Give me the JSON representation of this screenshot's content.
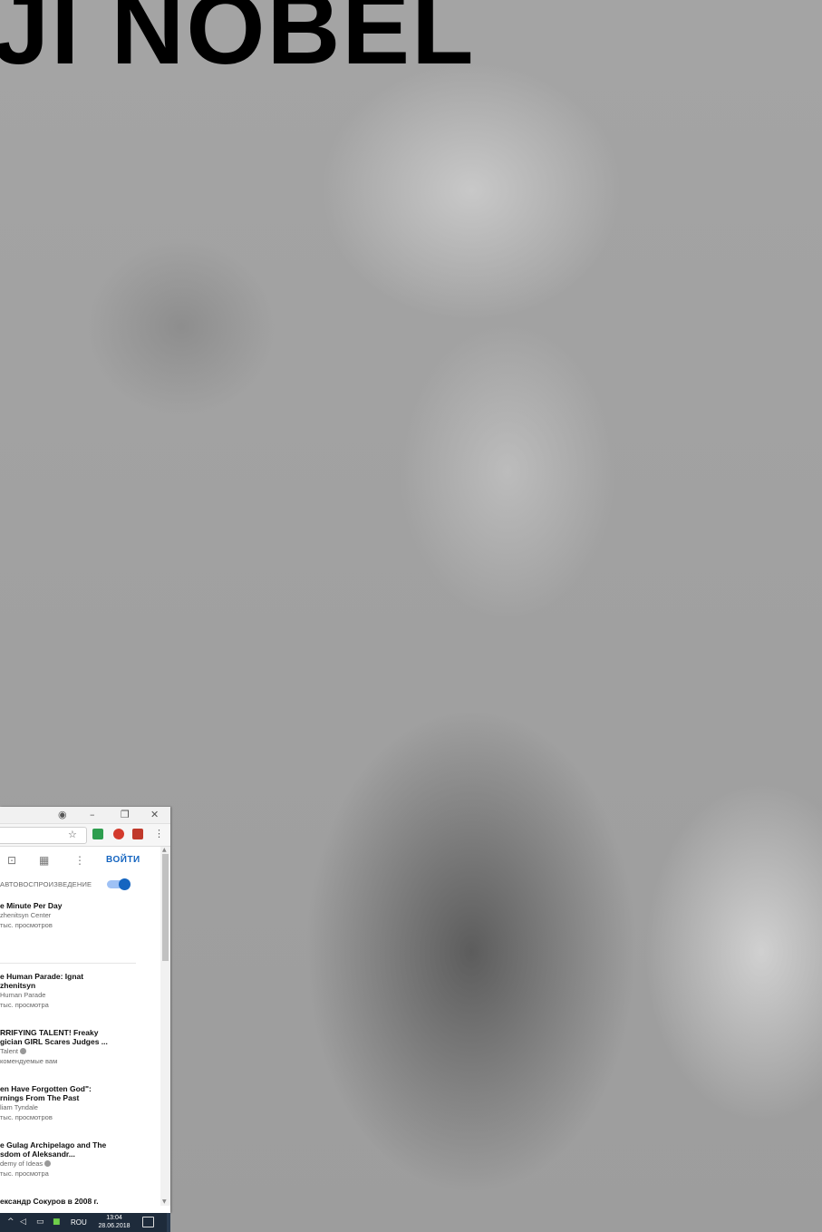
{
  "headline": "JI NOBEL",
  "window": {
    "titlebar": {
      "account_icon": "account-circle-icon",
      "minimize": "–",
      "restore": "❐",
      "close": "✕"
    },
    "addressbar": {
      "star_icon": "☆",
      "menu_icon": "⋮"
    },
    "header": {
      "camera_icon": "⊡",
      "apps_icon": "▦",
      "more_icon": "⋮",
      "signin_label": "ВОЙТИ"
    },
    "autoplay_label": "АВТОВОСПРОИЗВЕДЕНИЕ",
    "autoplay_on": true,
    "videos": [
      {
        "title": "e Minute Per Day",
        "channel": "zhenitsyn Center",
        "views": "тыс. просмотров"
      },
      {
        "title": "e Human Parade: Ignat",
        "title2": "zhenitsyn",
        "channel": "Human Parade",
        "views": "тыс. просмотра"
      },
      {
        "title": "RRIFYING TALENT! Freaky",
        "title2": "gician GIRL Scares Judges ...",
        "channel": "Talent",
        "views": "комендуемые вам"
      },
      {
        "title": "en Have Forgotten God\":",
        "title2": "rnings From The Past",
        "channel": "liam Tyndale",
        "views": "тыс. просмотров"
      },
      {
        "title": "e Gulag Archipelago and The",
        "title2": "sdom of Aleksandr...",
        "channel": "demy of Ideas",
        "views": "тыс. просмотра"
      },
      {
        "title": "ександр Сокуров в 2008 г."
      }
    ]
  },
  "taskbar": {
    "lang": "ROU",
    "time": "13:04",
    "date": "28.06.2018"
  },
  "colors": {
    "accent": "#1565c0",
    "taskbar": "#1e2b3b"
  }
}
